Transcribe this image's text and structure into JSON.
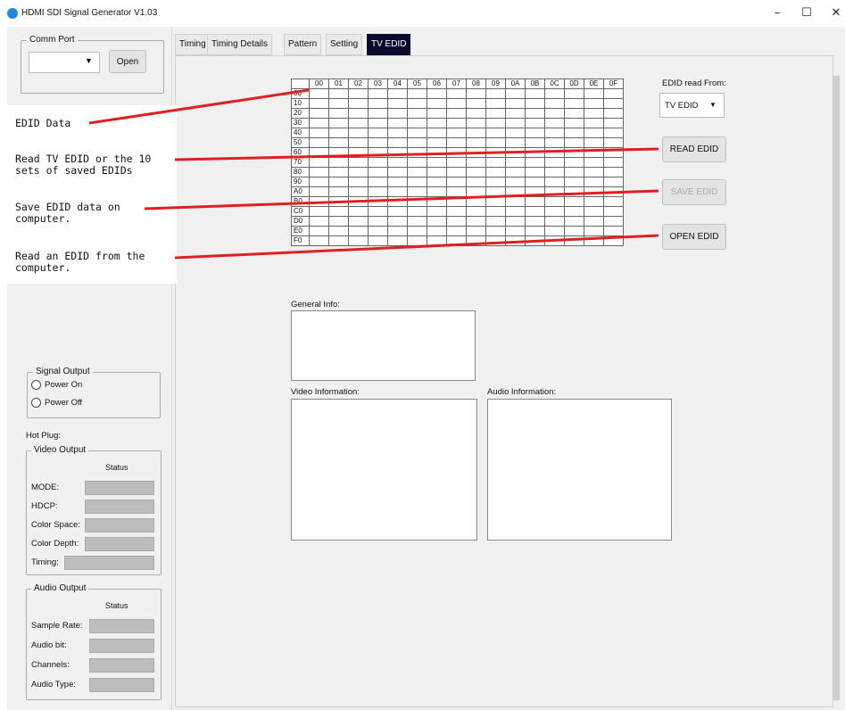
{
  "window": {
    "title": "HDMI SDI Signal Generator V1.03",
    "controls": {
      "minimize": "–",
      "maximize": "☐",
      "close": "✕"
    }
  },
  "comm_port": {
    "legend": "Comm Port",
    "selected": "",
    "open_label": "Open"
  },
  "signal_output": {
    "legend": "Signal Output",
    "power_on": "Power On",
    "power_off": "Power Off"
  },
  "hot_plug": {
    "label": "Hot Plug:"
  },
  "video_output": {
    "legend": "Video Output",
    "status_header": "Status",
    "fields": [
      "MODE:",
      "HDCP:",
      "Color Space:",
      "Color Depth:",
      "Timing:"
    ]
  },
  "audio_output": {
    "legend": "Audio Output",
    "status_header": "Status",
    "fields": [
      "Sample Rate:",
      "Audio bit:",
      "Channels:",
      "Audio Type:"
    ]
  },
  "tabs": [
    "Timing",
    "Timing Details",
    "Pattern",
    "Setting",
    "TV EDID"
  ],
  "active_tab": "TV EDID",
  "edid": {
    "col_headers": [
      "00",
      "01",
      "02",
      "03",
      "04",
      "05",
      "06",
      "07",
      "08",
      "09",
      "0A",
      "0B",
      "0C",
      "0D",
      "0E",
      "0F"
    ],
    "row_headers": [
      "00",
      "10",
      "20",
      "30",
      "40",
      "50",
      "60",
      "70",
      "80",
      "90",
      "A0",
      "B0",
      "C0",
      "D0",
      "E0",
      "F0"
    ],
    "read_from_label": "EDID read From:",
    "read_from_value": "TV EDID",
    "read_button": "READ EDID",
    "save_button": "SAVE EDID",
    "open_button": "OPEN EDID"
  },
  "info": {
    "general": "General Info:",
    "video": "Video Information:",
    "audio": "Audio Information:"
  },
  "annotations": {
    "edid_data": "EDID Data",
    "read": "Read TV EDID or the 10\nsets of saved EDIDs",
    "save": "Save EDID data on\ncomputer.",
    "open": "Read an EDID from the\ncomputer.",
    "line_color": "#e02020"
  },
  "colors": {
    "active_tab_bg": "#0b0b2e",
    "app_icon": "#1e88e5"
  }
}
